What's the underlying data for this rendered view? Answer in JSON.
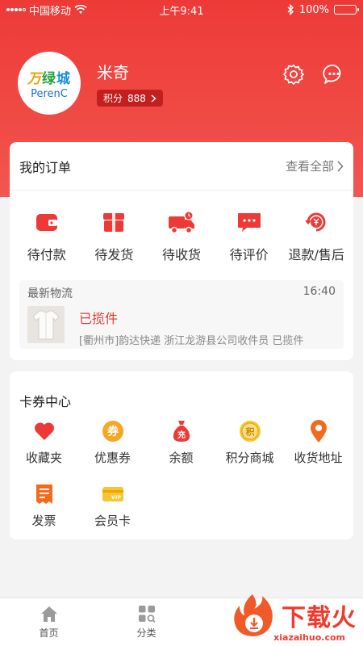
{
  "status_bar": {
    "carrier": "中国移动",
    "time": "上午9:41",
    "battery": "100%"
  },
  "profile": {
    "logo_cn_1": "万",
    "logo_cn_2": "绿",
    "logo_cn_3": "城",
    "logo_en": "PerenC",
    "username": "米奇",
    "points_label": "积分",
    "points_value": "888"
  },
  "orders": {
    "title": "我的订单",
    "see_all": "查看全部",
    "items": [
      {
        "label": "待付款",
        "icon": "wallet-icon"
      },
      {
        "label": "待发货",
        "icon": "package-icon"
      },
      {
        "label": "待收货",
        "icon": "truck-icon"
      },
      {
        "label": "待评价",
        "icon": "comment-icon"
      },
      {
        "label": "退款/售后",
        "icon": "refund-icon"
      }
    ],
    "logistics": {
      "title": "最新物流",
      "time": "16:40",
      "status": "已揽件",
      "detail": "[衢州市]韵达快递 浙江龙游县公司收件员 已揽件"
    }
  },
  "coupons": {
    "title": "卡券中心",
    "items": [
      {
        "label": "收藏夹",
        "icon": "heart-icon"
      },
      {
        "label": "优惠券",
        "icon": "coupon-icon",
        "glyph": "券"
      },
      {
        "label": "余额",
        "icon": "money-bag-icon",
        "glyph": "充"
      },
      {
        "label": "积分商城",
        "icon": "points-coin-icon",
        "glyph": "积"
      },
      {
        "label": "收货地址",
        "icon": "location-pin-icon"
      },
      {
        "label": "发票",
        "icon": "invoice-icon"
      },
      {
        "label": "会员卡",
        "icon": "vip-card-icon",
        "glyph": "VIP"
      }
    ]
  },
  "tabbar": {
    "tabs": [
      {
        "label": "首页"
      },
      {
        "label": "分类"
      }
    ]
  },
  "watermark": {
    "cn": "下载火",
    "en": "xiazaihuo.com"
  },
  "colors": {
    "brand_red": "#ee3a37",
    "badge_red": "#c2201f",
    "orange": "#f5a623"
  }
}
